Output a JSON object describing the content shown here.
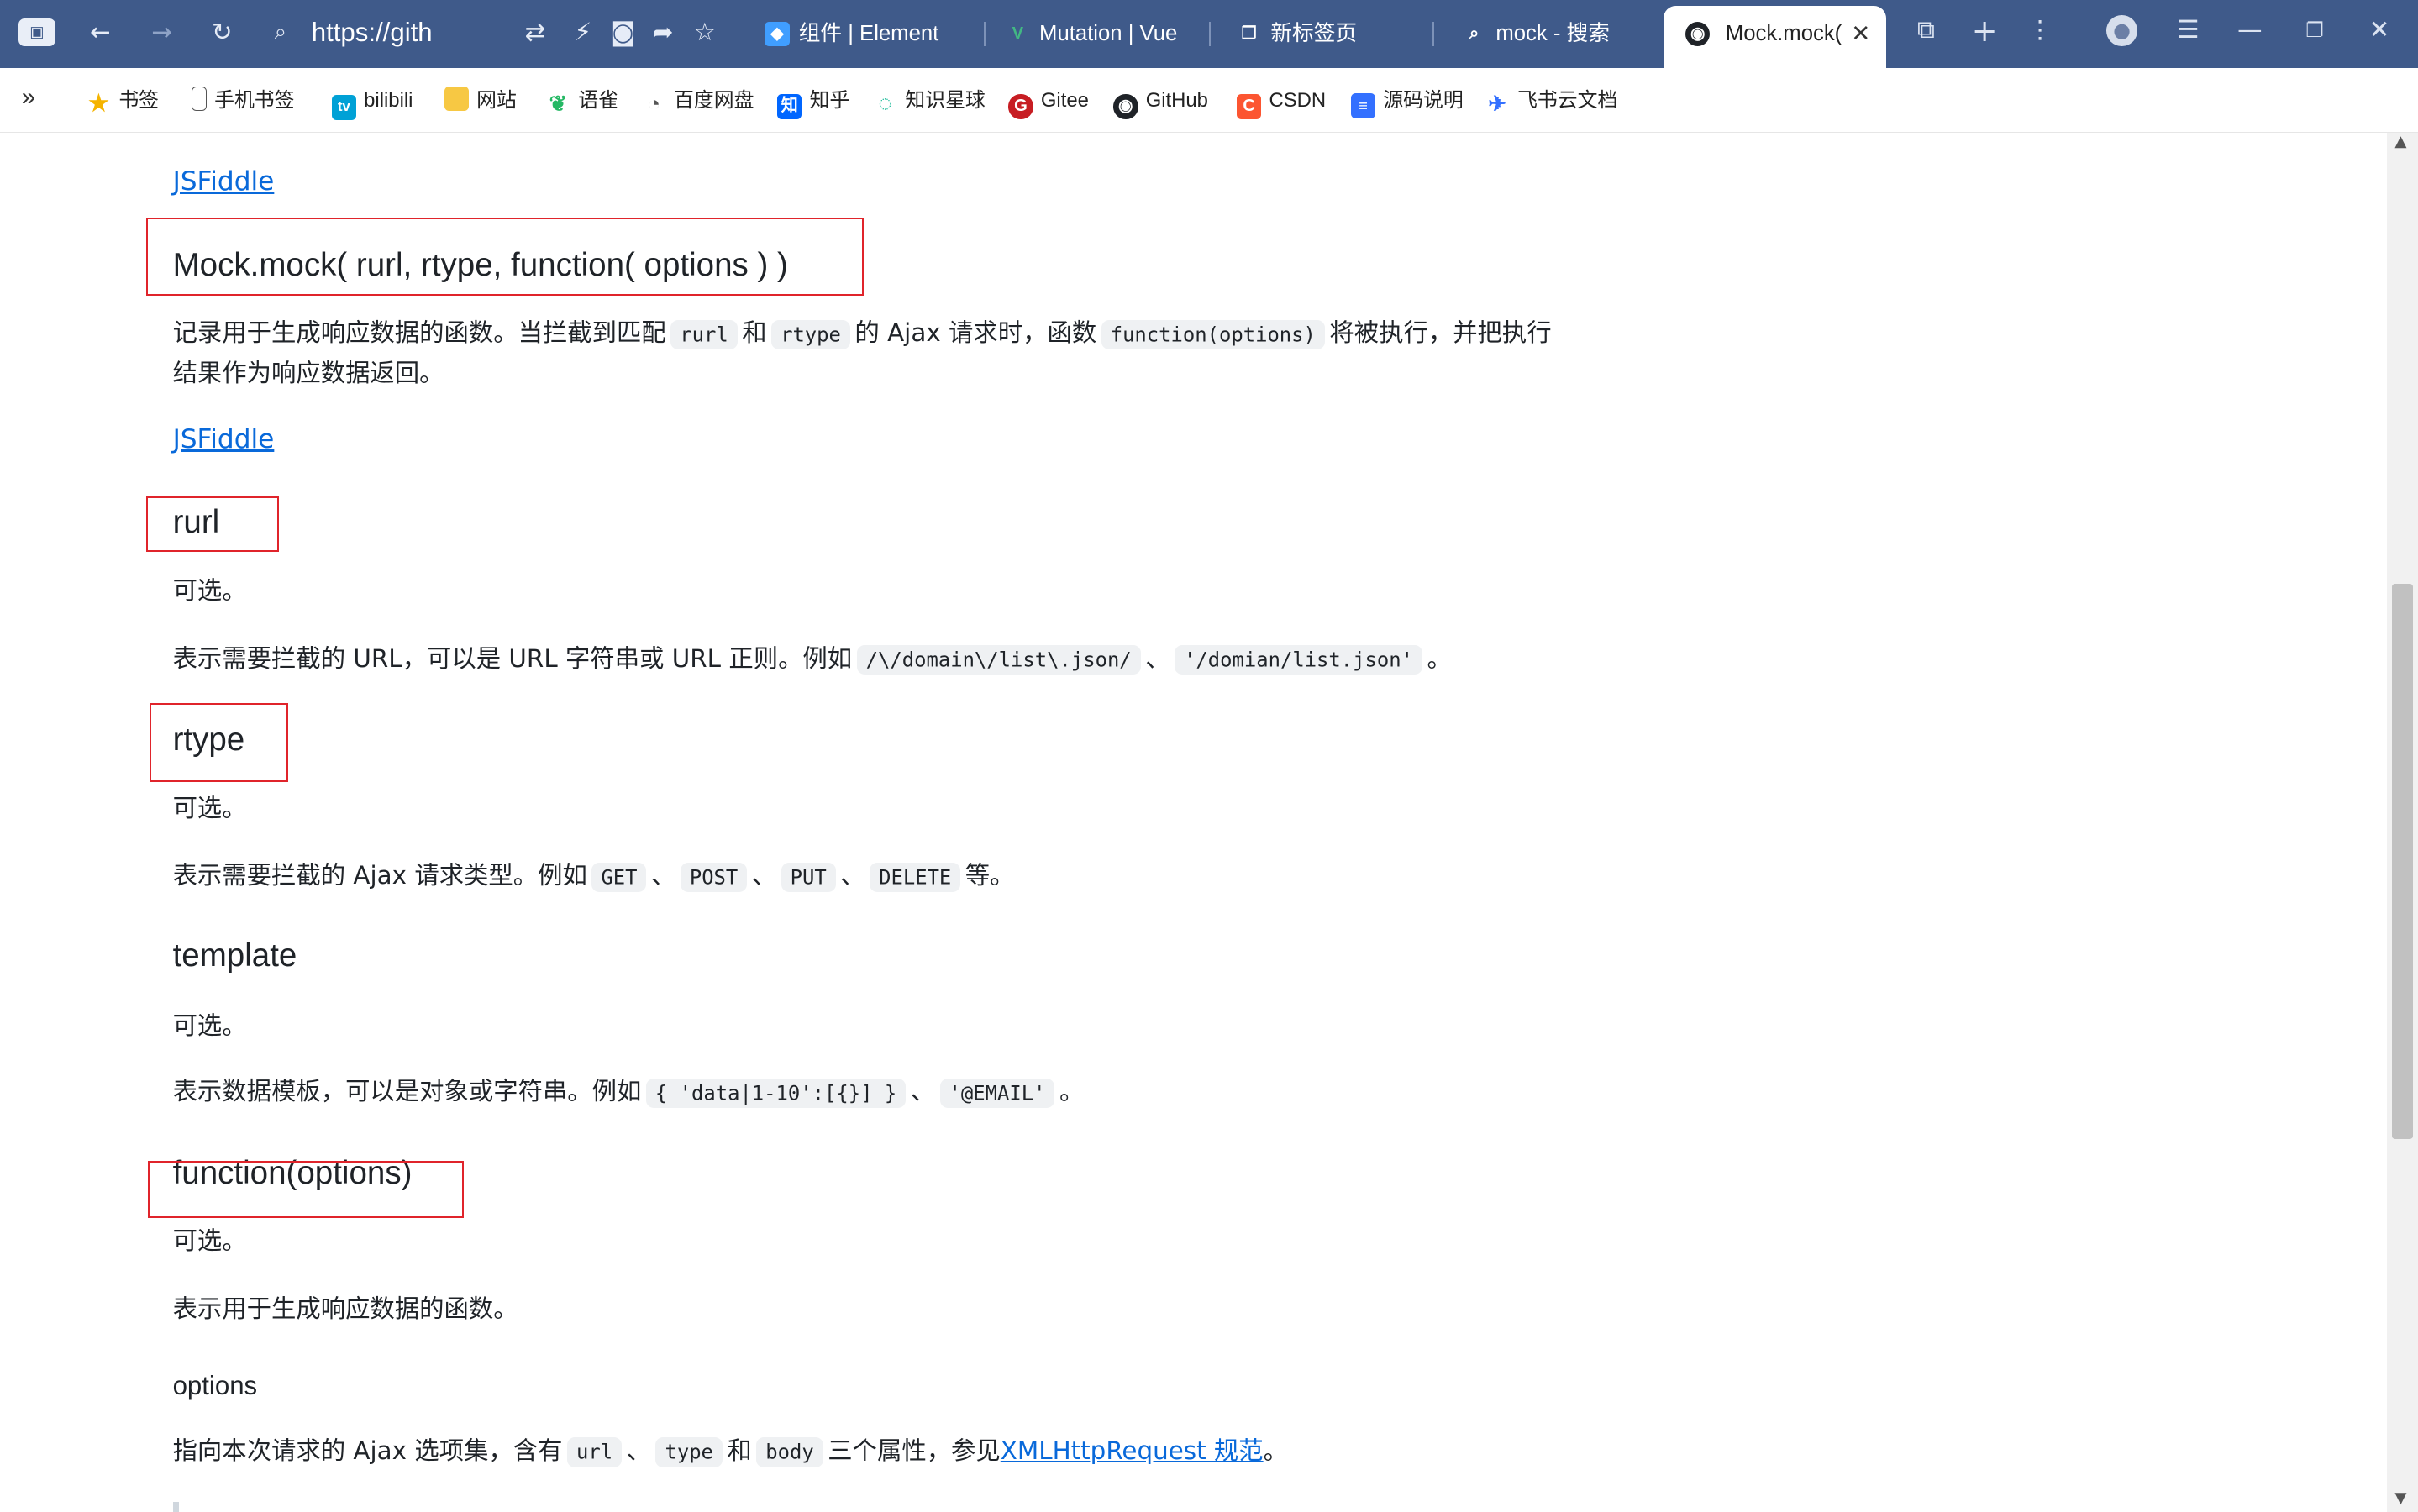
{
  "browser": {
    "url": "https://gith",
    "tabs": [
      {
        "label": "组件 | Element"
      },
      {
        "label": "Mutation | Vue"
      },
      {
        "label": "新标签页"
      },
      {
        "label": "mock - 搜索"
      },
      {
        "label": "Mock.mock("
      }
    ],
    "close_tab": "✕",
    "bookmarks": [
      {
        "label": "书签"
      },
      {
        "label": "手机书签"
      },
      {
        "label": "bilibili"
      },
      {
        "label": "网站"
      },
      {
        "label": "语雀"
      },
      {
        "label": "百度网盘"
      },
      {
        "label": "知乎"
      },
      {
        "label": "知识星球"
      },
      {
        "label": "Gitee"
      },
      {
        "label": "GitHub"
      },
      {
        "label": "CSDN"
      },
      {
        "label": "源码说明"
      },
      {
        "label": "飞书云文档"
      }
    ]
  },
  "doc": {
    "link1": "JSFiddle",
    "section_main": {
      "heading": "Mock.mock( rurl, rtype, function( options ) )",
      "desc_a": "记录用于生成响应数据的函数。当拦截到匹配",
      "code_rurl": "rurl",
      "and1": "和",
      "code_rtype": "rtype",
      "desc_b": "的 Ajax 请求时，函数",
      "code_fn": "function(options)",
      "desc_c": "将被执行，并把执行",
      "desc_line2": "结果作为响应数据返回。",
      "link": "JSFiddle"
    },
    "rurl": {
      "heading": "rurl",
      "optional": "可选。",
      "desc_a": "表示需要拦截的 URL，可以是 URL 字符串或 URL 正则。例如",
      "code1": "/\\/domain\\/list\\.json/",
      "sep": "、",
      "code2": "'/domian/list.json'",
      "end": "。"
    },
    "rtype": {
      "heading": "rtype",
      "optional": "可选。",
      "desc_a": "表示需要拦截的 Ajax 请求类型。例如",
      "codes": [
        "GET",
        "POST",
        "PUT",
        "DELETE"
      ],
      "sep": "、",
      "end": "等。"
    },
    "template": {
      "heading": "template",
      "optional": "可选。",
      "desc_a": "表示数据模板，可以是对象或字符串。例如",
      "code1": "{ 'data|1-10':[{}] }",
      "sep": "、",
      "code2": "'@EMAIL'",
      "end": "。"
    },
    "function_options": {
      "heading": "function(options)",
      "optional": "可选。",
      "desc": "表示用于生成响应数据的函数。"
    },
    "options": {
      "heading": "options",
      "desc_a": "指向本次请求的 Ajax 选项集，含有",
      "code1": "url",
      "sep": "、",
      "code2": "type",
      "and": "和",
      "code3": "body",
      "desc_b": "三个属性，参见",
      "link": "XMLHttpRequest 规范",
      "end": "。"
    }
  },
  "colors": {
    "tabbar": "#3f5a8a",
    "link": "#0969da",
    "annotation_box": "#e0242b",
    "code_bg": "#eff1f3"
  },
  "scroll_position": 0.55
}
